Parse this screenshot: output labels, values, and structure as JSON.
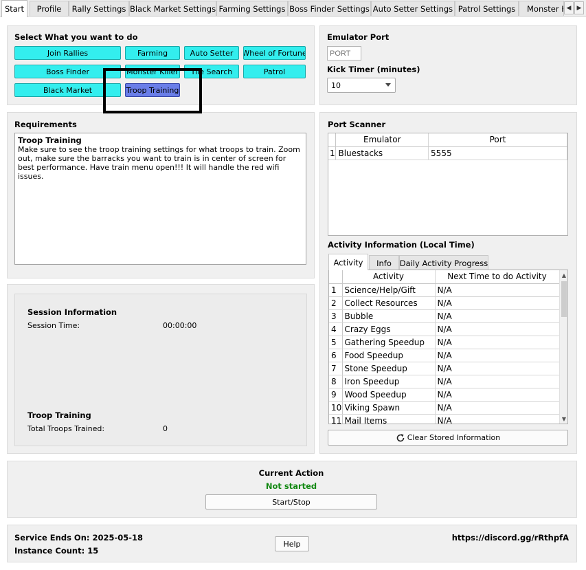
{
  "tabs": [
    {
      "label": "Start",
      "active": true
    },
    {
      "label": "Profile"
    },
    {
      "label": "Rally Settings"
    },
    {
      "label": "Black Market Settings"
    },
    {
      "label": "Farming Settings"
    },
    {
      "label": "Boss Finder Settings"
    },
    {
      "label": "Auto Setter Settings"
    },
    {
      "label": "Patrol Settings"
    },
    {
      "label": "Monster Kil"
    }
  ],
  "tab_scroll": {
    "left": "◀",
    "right": "▶"
  },
  "select_panel": {
    "title": "Select What you want to do",
    "buttons": [
      {
        "label": "Join Rallies"
      },
      {
        "label": "Farming"
      },
      {
        "label": "Auto Setter"
      },
      {
        "label": "Wheel of Fortune"
      },
      {
        "label": "Boss Finder"
      },
      {
        "label": "Monster Killer"
      },
      {
        "label": "Tile Search"
      },
      {
        "label": "Patrol"
      },
      {
        "label": "Black Market"
      },
      {
        "label": "Troop Training",
        "selected": true
      }
    ]
  },
  "emulator_panel": {
    "port_title": "Emulator Port",
    "port_placeholder": "PORT",
    "kick_title": "Kick Timer (minutes)",
    "kick_value": "10"
  },
  "requirements": {
    "title": "Requirements",
    "heading": "Troop Training",
    "body": "Make sure to see the troop training settings for what troops to train. Zoom out, make sure the barracks you want to train is in center of screen for best performance. Have train menu open!!! It will handle the red wifi issues."
  },
  "port_scanner": {
    "title": "Port Scanner",
    "columns": [
      "Emulator",
      "Port"
    ],
    "rows": [
      {
        "n": "1",
        "emulator": "Bluestacks",
        "port": "5555"
      }
    ]
  },
  "activity": {
    "title": "Activity Information (Local Time)",
    "tabs": [
      {
        "label": "Activity",
        "active": true
      },
      {
        "label": "Info"
      },
      {
        "label": "Daily Activity Progress"
      }
    ],
    "columns": [
      "Activity",
      "Next Time to do Activity"
    ],
    "rows": [
      {
        "n": "1",
        "activity": "Science/Help/Gift",
        "next": "N/A"
      },
      {
        "n": "2",
        "activity": "Collect Resources",
        "next": "N/A"
      },
      {
        "n": "3",
        "activity": "Bubble",
        "next": "N/A"
      },
      {
        "n": "4",
        "activity": "Crazy Eggs",
        "next": "N/A"
      },
      {
        "n": "5",
        "activity": "Gathering Speedup",
        "next": "N/A"
      },
      {
        "n": "6",
        "activity": "Food Speedup",
        "next": "N/A"
      },
      {
        "n": "7",
        "activity": "Stone Speedup",
        "next": "N/A"
      },
      {
        "n": "8",
        "activity": "Iron Speedup",
        "next": "N/A"
      },
      {
        "n": "9",
        "activity": "Wood Speedup",
        "next": "N/A"
      },
      {
        "n": "10",
        "activity": "Viking Spawn",
        "next": "N/A"
      },
      {
        "n": "11",
        "activity": "Mail Items",
        "next": "N/A"
      }
    ],
    "clear_button": "Clear Stored Information",
    "clear_icon": "refresh-icon"
  },
  "session": {
    "title": "Session Information",
    "time_label": "Session Time:",
    "time_value": "00:00:00",
    "troop_title": "Troop Training",
    "trained_label": "Total Troops Trained:",
    "trained_value": "0"
  },
  "current_action": {
    "title": "Current Action",
    "status": "Not started",
    "button": "Start/Stop",
    "status_color": "#118811"
  },
  "footer": {
    "service_ends": "Service Ends On: 2025-05-18",
    "instance_count": "Instance Count: 15",
    "help_button": "Help",
    "discord": "https://discord.gg/rRthpfA"
  },
  "colors": {
    "action_button": "#33eeee",
    "action_button_selected": "#6a7ee8"
  }
}
